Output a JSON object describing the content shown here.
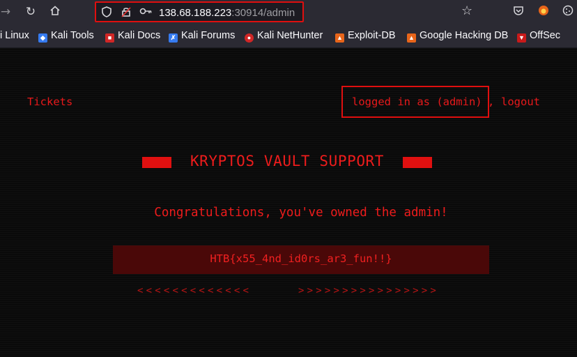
{
  "browser": {
    "url_host": "138.68.188.223",
    "url_rest": ":30914/admin",
    "icons": {
      "back": "back-arrow-icon",
      "reload": "reload-icon",
      "home": "home-icon",
      "shield": "shield-icon",
      "permissions": "permissions-icon",
      "key": "key-icon",
      "star": "star-icon",
      "pocket": "pocket-icon",
      "extension_fox": "extension-icon",
      "cookie": "cookie-icon"
    }
  },
  "bookmarks": [
    {
      "label": "i Linux",
      "color": "#2b2a33"
    },
    {
      "label": "Kali Tools",
      "color": "#367bf0"
    },
    {
      "label": "Kali Docs",
      "color": "#d12626"
    },
    {
      "label": "Kali Forums",
      "color": "#367bf0"
    },
    {
      "label": "Kali NetHunter",
      "color": "#d12626"
    },
    {
      "label": "Exploit-DB",
      "color": "#e8651a"
    },
    {
      "label": "Google Hacking DB",
      "color": "#e8651a"
    },
    {
      "label": "OffSec",
      "color": "#c81a1a"
    }
  ],
  "page": {
    "nav_tickets": "Tickets",
    "logged_in": "logged in as (admin)",
    "comma": ",",
    "logout": "logout",
    "title": "KRYPTOS VAULT SUPPORT",
    "congrats": "Congratulations, you've owned the admin!",
    "flag": "HTB{x55_4nd_id0rs_ar3_fun!!}",
    "left_arrows": "<<<<<<<<<<<<<",
    "right_arrows": ">>>>>>>>>>>>>>>>",
    "accent_color": "#e01010"
  }
}
